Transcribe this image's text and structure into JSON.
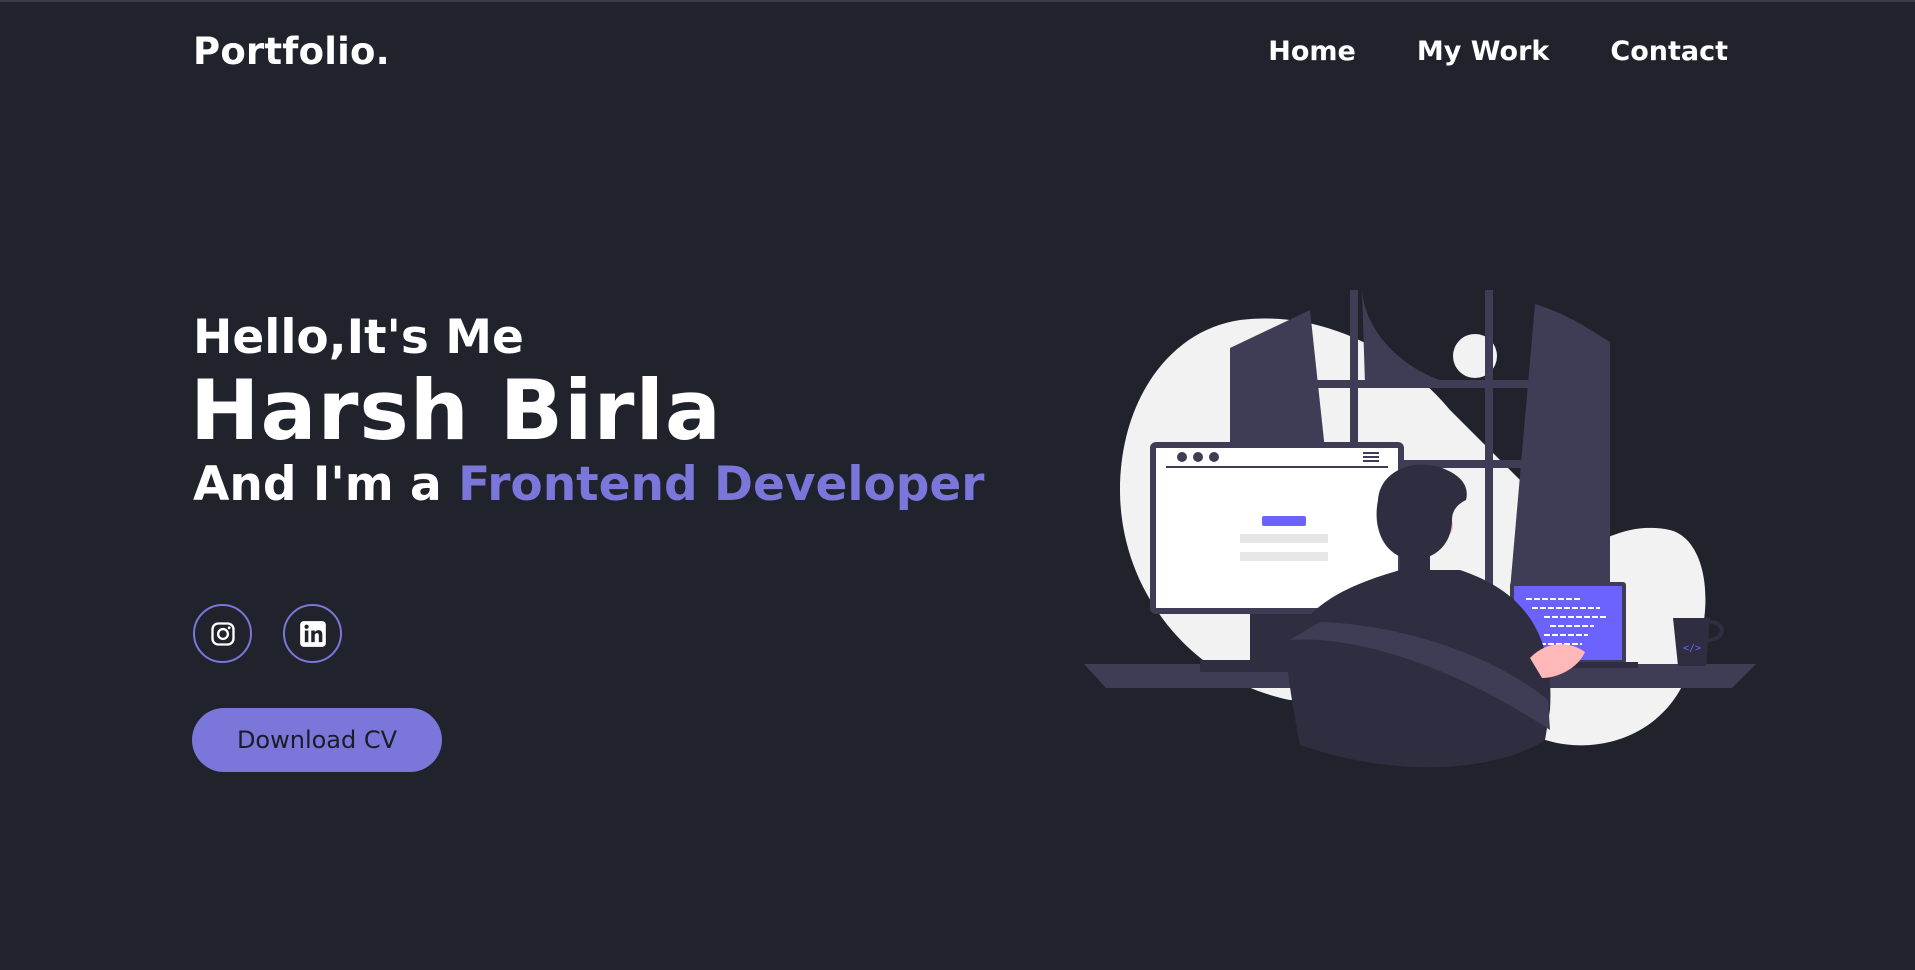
{
  "header": {
    "logo": "Portfolio.",
    "nav": [
      {
        "label": "Home"
      },
      {
        "label": "My Work"
      },
      {
        "label": "Contact"
      }
    ]
  },
  "hero": {
    "greeting": "Hello,It's Me",
    "name": "Harsh Birla",
    "role_prefix": "And I'm a ",
    "role_highlight": "Frontend Developer"
  },
  "socials": [
    {
      "icon": "instagram-icon"
    },
    {
      "icon": "linkedin-icon"
    }
  ],
  "cta": {
    "label": "Download CV"
  },
  "colors": {
    "background": "#20232c",
    "accent": "#7b76d9",
    "text": "#ffffff",
    "button_text": "#1b1d26"
  }
}
